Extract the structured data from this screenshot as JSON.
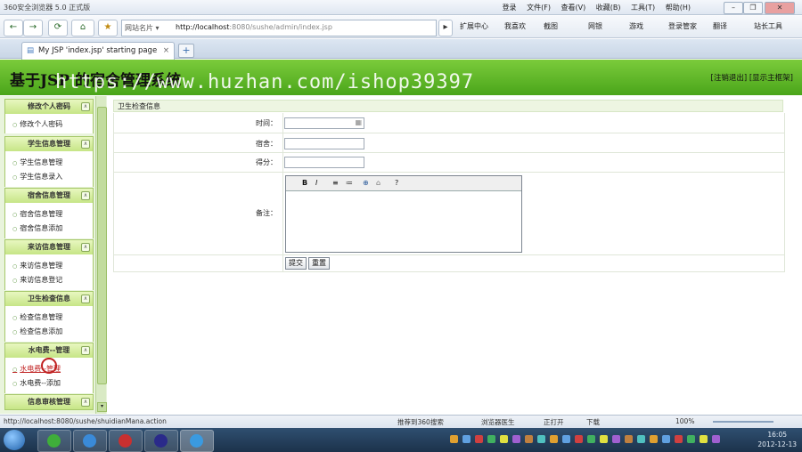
{
  "browser": {
    "title": "360安全浏览器 5.0 正式版",
    "menu": [
      "登录",
      "文件(F)",
      "查看(V)",
      "收藏(B)",
      "工具(T)",
      "帮助(H)"
    ],
    "back": "←",
    "forward": "→",
    "refresh": "⟳",
    "home": "⌂",
    "favorite": "★",
    "url_prefix": "网站名片 ▾",
    "url_host": "http://localhost",
    "url_rest": ":8080/sushe/admin/index.jsp",
    "toolbar": [
      "扩展中心",
      "我喜欢",
      "截图",
      "网银",
      "游戏",
      "登录管家",
      "翻译",
      "站长工具"
    ],
    "tab_title": "My JSP 'index.jsp' starting page",
    "tab_close": "×",
    "new_tab": "+"
  },
  "page": {
    "site_title": "基于JSP 的宿舍管理系统",
    "watermark": "https://www.huzhan.com/ishop39397",
    "header_links": "[注销退出] [显示主框架]"
  },
  "sidebar": {
    "collapse_symbol": "∧",
    "sections": [
      {
        "title": "修改个人密码",
        "items": [
          "修改个人密码"
        ]
      },
      {
        "title": "学生信息管理",
        "items": [
          "学生信息管理",
          "学生信息录入"
        ]
      },
      {
        "title": "宿舍信息管理",
        "items": [
          "宿舍信息管理",
          "宿舍信息添加"
        ]
      },
      {
        "title": "来访信息管理",
        "items": [
          "来访信息管理",
          "来访信息登记"
        ]
      },
      {
        "title": "卫生检查信息",
        "items": [
          "检查信息管理",
          "检查信息添加"
        ]
      },
      {
        "title": "水电费--管理",
        "items": [
          "水电费--管理",
          "水电费--添加"
        ]
      },
      {
        "title": "信息审核管理",
        "items": []
      }
    ]
  },
  "form": {
    "title": "卫生检查信息",
    "labels": {
      "time": "时间：",
      "dorm": "宿舍：",
      "score": "得分：",
      "remark": "备注："
    },
    "values": {
      "time": "",
      "dorm": "",
      "score": "",
      "remark": ""
    },
    "editor_tools": [
      "B",
      "I",
      "≡",
      "≔",
      "⊕",
      "⌂",
      "?"
    ],
    "submit": "提交",
    "reset": "重置"
  },
  "status": {
    "url": "http://localhost:8080/sushe/shuidianMana.action",
    "items": [
      "推荐到360搜索",
      "浏览器医生",
      "正打开",
      "下载"
    ],
    "zoom": "100%"
  },
  "taskbar": {
    "time": "16:05",
    "date": "2012-12-13"
  },
  "colors": {
    "banner": "#5fb52a",
    "sidebar_header": "#c6e586",
    "form_title_bg": "#edf5e2"
  }
}
